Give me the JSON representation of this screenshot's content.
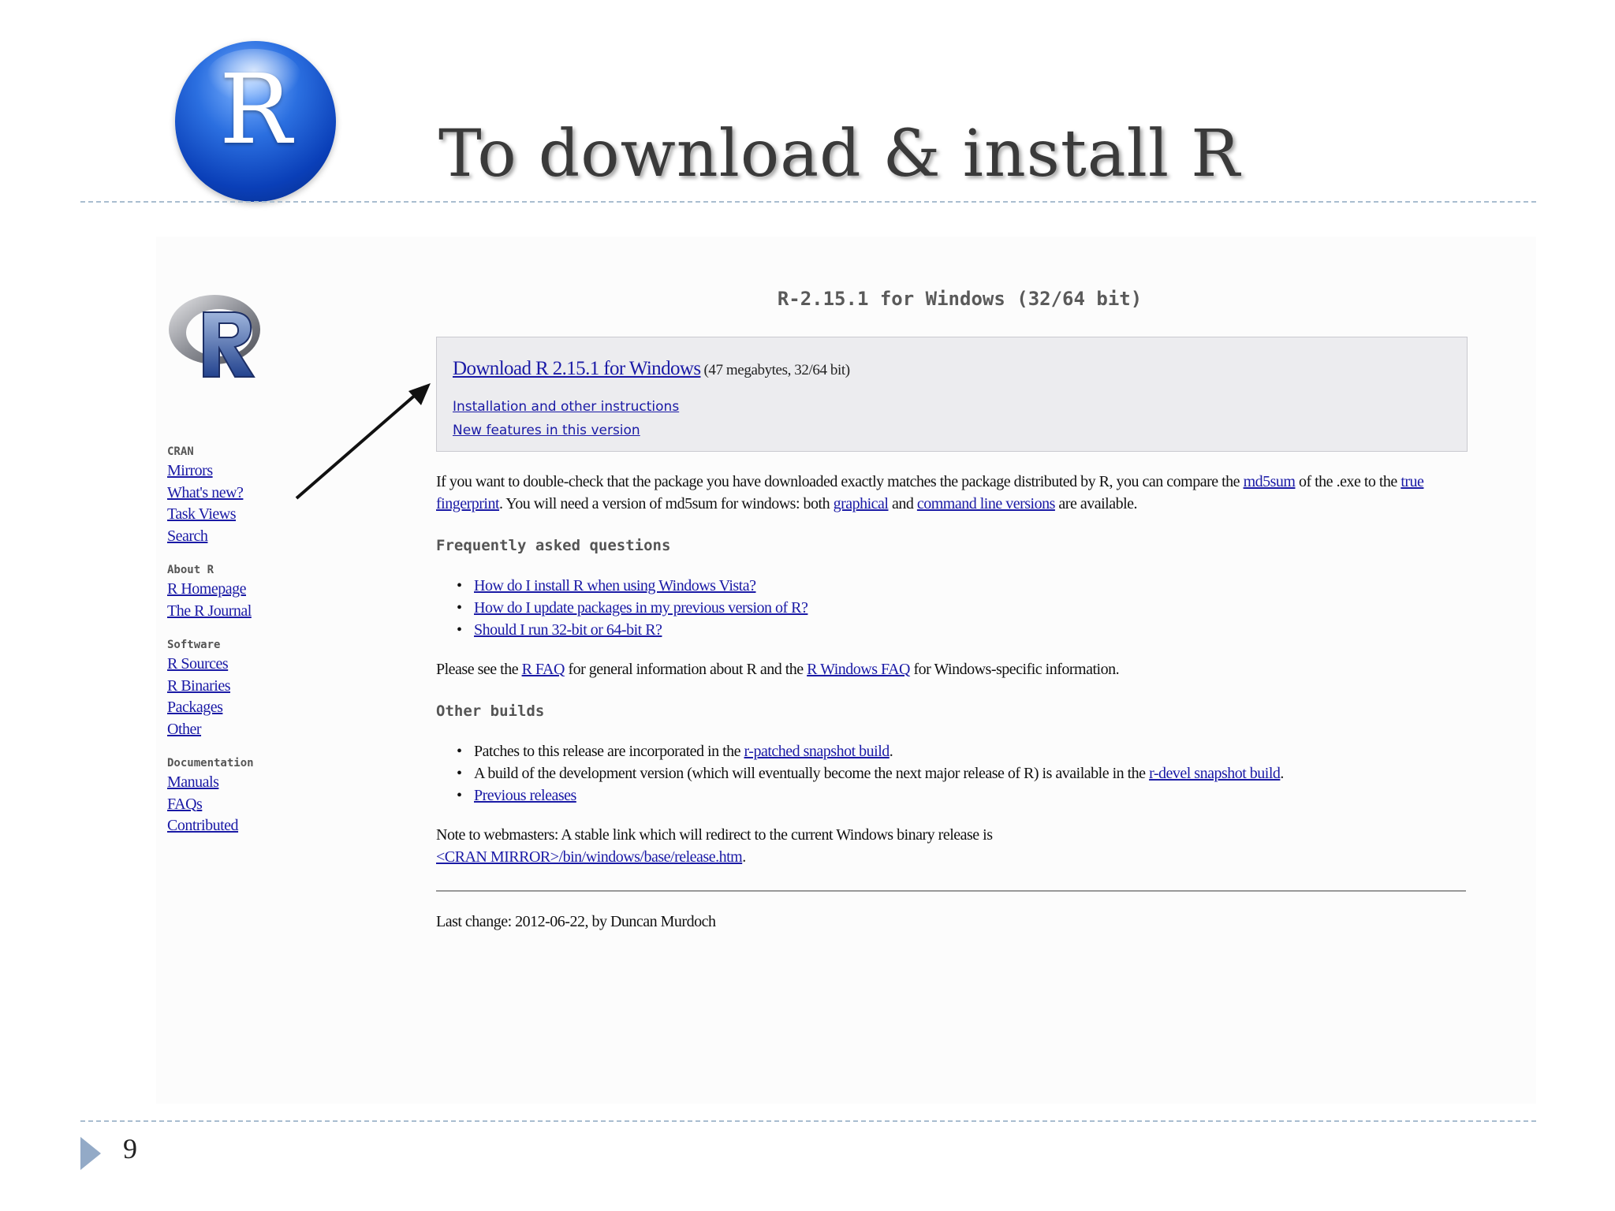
{
  "slide": {
    "logo_letter": "R",
    "title": "To download & install R",
    "page_number": "9"
  },
  "sidebar": {
    "groups": [
      {
        "heading": "CRAN",
        "links": [
          "Mirrors",
          "What's new?",
          "Task Views",
          "Search"
        ]
      },
      {
        "heading": "About R",
        "links": [
          "R Homepage",
          "The R Journal"
        ]
      },
      {
        "heading": "Software",
        "links": [
          "R Sources",
          "R Binaries",
          "Packages",
          "Other"
        ]
      },
      {
        "heading": "Documentation",
        "links": [
          "Manuals",
          "FAQs",
          "Contributed"
        ]
      }
    ]
  },
  "page": {
    "heading": "R-2.15.1 for Windows (32/64 bit)",
    "download_link": "Download R 2.15.1 for Windows",
    "download_size": "(47 megabytes, 32/64 bit)",
    "install_link": "Installation and other instructions",
    "features_link": "New features in this version",
    "check": {
      "t1": "If you want to double-check that the package you have downloaded exactly matches the package distributed by R, you can compare the ",
      "md5sum_link": "md5sum",
      "t2": " of the .exe to the ",
      "true_link": "true",
      "fingerprint_link": "fingerprint",
      "t3": ". You will need a version of md5sum for windows: both ",
      "graphical_link": "graphical",
      "t4": " and ",
      "cmd_link": "command line versions",
      "t5": " are available."
    },
    "faq_heading": "Frequently asked questions",
    "faq_items": [
      "How do I install R when using Windows Vista?",
      "How do I update packages in my previous version of R?",
      "Should I run 32-bit or 64-bit R?"
    ],
    "see": {
      "t1": "Please see the ",
      "rfaq_link": "R FAQ",
      "t2": " for general information about R and the ",
      "rwinfaq_link": "R Windows FAQ",
      "t3": " for Windows-specific information."
    },
    "other_heading": "Other builds",
    "other": {
      "b1_text": "Patches to this release are incorporated in the ",
      "b1_link": "r-patched snapshot build",
      "b1_end": ".",
      "b2_text": "A build of the development version (which will eventually become the next major release of R) is available in the ",
      "b2_link": "r-devel snapshot build",
      "b2_end": ".",
      "b3_link": "Previous releases"
    },
    "note": {
      "t1": "Note to webmasters: A stable link which will redirect to the current Windows binary release is",
      "link": "<CRAN MIRROR>/bin/windows/base/release.htm",
      "end": "."
    },
    "last_change": "Last change: 2012-06-22, by Duncan Murdoch"
  }
}
